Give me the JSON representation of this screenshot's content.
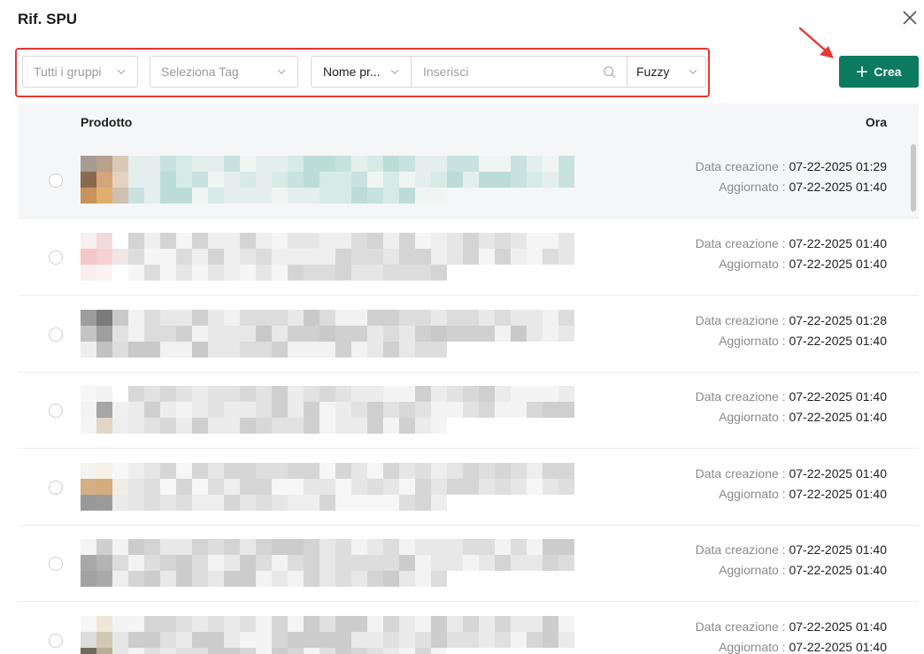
{
  "dialog": {
    "title": "Rif. SPU"
  },
  "filters": {
    "group_placeholder": "Tutti i gruppi",
    "tag_placeholder": "Seleziona Tag",
    "search_field": "Nome pr...",
    "search_placeholder": "Inserisci",
    "match_mode": "Fuzzy"
  },
  "actions": {
    "create_label": "Crea"
  },
  "table": {
    "columns": {
      "product": "Prodotto",
      "time": "Ora"
    },
    "created_label": "Data creazione :",
    "updated_label": "Aggiornato :",
    "rows": [
      {
        "created": "07-22-2025 01:29",
        "updated": "07-22-2025 01:40"
      },
      {
        "created": "07-22-2025 01:40",
        "updated": "07-22-2025 01:40"
      },
      {
        "created": "07-22-2025 01:28",
        "updated": "07-22-2025 01:40"
      },
      {
        "created": "07-22-2025 01:40",
        "updated": "07-22-2025 01:40"
      },
      {
        "created": "07-22-2025 01:40",
        "updated": "07-22-2025 01:40"
      },
      {
        "created": "07-22-2025 01:40",
        "updated": "07-22-2025 01:40"
      },
      {
        "created": "07-22-2025 01:40",
        "updated": "07-22-2025 01:40"
      }
    ]
  },
  "colors": {
    "accent": "#0b7a5f",
    "highlight": "#e53935",
    "header_bg": "#f5f6f8"
  }
}
